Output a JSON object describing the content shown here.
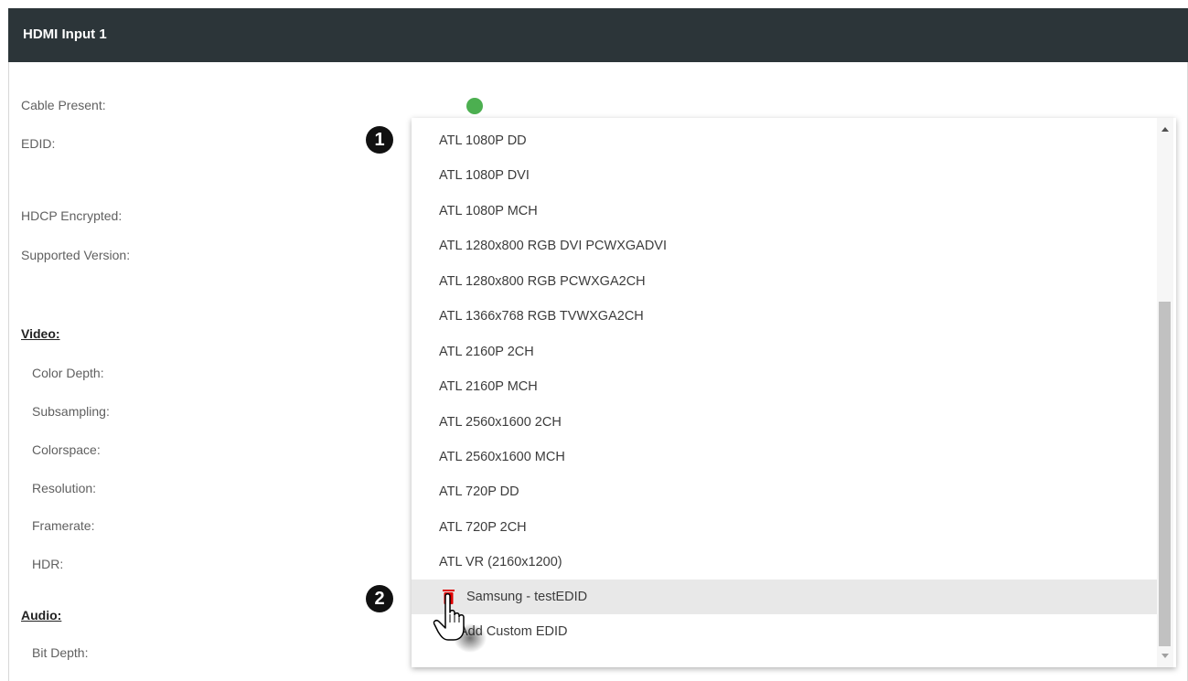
{
  "header": {
    "title": "HDMI Input 1"
  },
  "fields": {
    "cable_present": "Cable Present:",
    "edid": "EDID:",
    "hdcp_encrypted": "HDCP Encrypted:",
    "supported_version": "Supported Version:"
  },
  "video": {
    "heading": "Video:",
    "color_depth": "Color Depth:",
    "subsampling": "Subsampling:",
    "colorspace": "Colorspace:",
    "resolution": "Resolution:",
    "framerate": "Framerate:",
    "hdr": "HDR:"
  },
  "audio": {
    "heading": "Audio:",
    "bit_depth": "Bit Depth:"
  },
  "status": {
    "cable_present_color": "#4caf50"
  },
  "dropdown": {
    "options": [
      "ATL 1080P DD",
      "ATL 1080P DVI",
      "ATL 1080P MCH",
      "ATL 1280x800 RGB DVI PCWXGADVI",
      "ATL 1280x800 RGB PCWXGA2CH",
      "ATL 1366x768 RGB TVWXGA2CH",
      "ATL 2160P 2CH",
      "ATL 2160P MCH",
      "ATL 2560x1600 2CH",
      "ATL 2560x1600 MCH",
      "ATL 720P DD",
      "ATL 720P 2CH",
      "ATL VR (2160x1200)",
      "Samsung - testEDID",
      "Add Custom EDID"
    ],
    "highlighted_index": 13
  },
  "callouts": {
    "one": "1",
    "two": "2"
  },
  "icons": {
    "delete": "trash-icon",
    "cursor": "hand-pointer-icon"
  }
}
